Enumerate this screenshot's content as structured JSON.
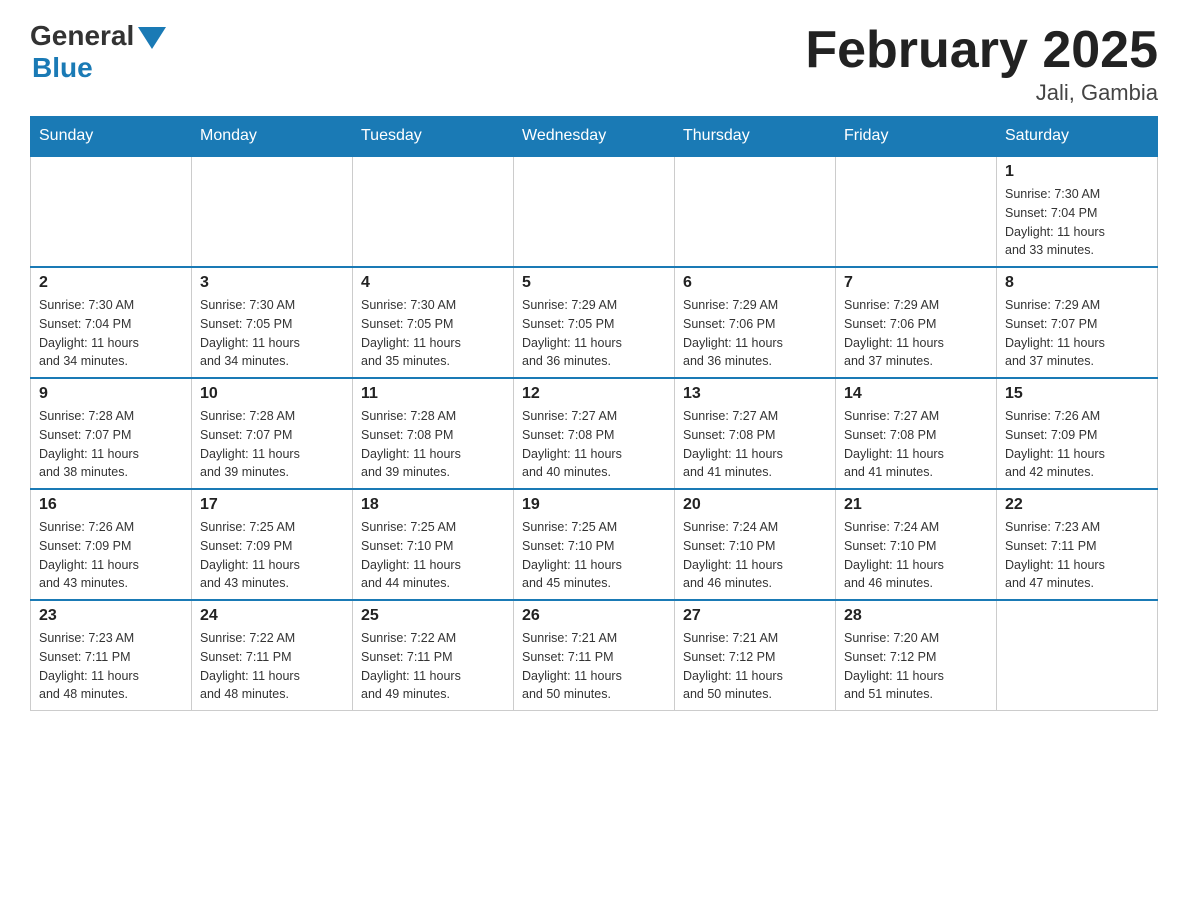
{
  "header": {
    "logo_general": "General",
    "logo_blue": "Blue",
    "title": "February 2025",
    "location": "Jali, Gambia"
  },
  "days_of_week": [
    "Sunday",
    "Monday",
    "Tuesday",
    "Wednesday",
    "Thursday",
    "Friday",
    "Saturday"
  ],
  "weeks": [
    {
      "days": [
        {
          "number": "",
          "info": ""
        },
        {
          "number": "",
          "info": ""
        },
        {
          "number": "",
          "info": ""
        },
        {
          "number": "",
          "info": ""
        },
        {
          "number": "",
          "info": ""
        },
        {
          "number": "",
          "info": ""
        },
        {
          "number": "1",
          "info": "Sunrise: 7:30 AM\nSunset: 7:04 PM\nDaylight: 11 hours\nand 33 minutes."
        }
      ]
    },
    {
      "days": [
        {
          "number": "2",
          "info": "Sunrise: 7:30 AM\nSunset: 7:04 PM\nDaylight: 11 hours\nand 34 minutes."
        },
        {
          "number": "3",
          "info": "Sunrise: 7:30 AM\nSunset: 7:05 PM\nDaylight: 11 hours\nand 34 minutes."
        },
        {
          "number": "4",
          "info": "Sunrise: 7:30 AM\nSunset: 7:05 PM\nDaylight: 11 hours\nand 35 minutes."
        },
        {
          "number": "5",
          "info": "Sunrise: 7:29 AM\nSunset: 7:05 PM\nDaylight: 11 hours\nand 36 minutes."
        },
        {
          "number": "6",
          "info": "Sunrise: 7:29 AM\nSunset: 7:06 PM\nDaylight: 11 hours\nand 36 minutes."
        },
        {
          "number": "7",
          "info": "Sunrise: 7:29 AM\nSunset: 7:06 PM\nDaylight: 11 hours\nand 37 minutes."
        },
        {
          "number": "8",
          "info": "Sunrise: 7:29 AM\nSunset: 7:07 PM\nDaylight: 11 hours\nand 37 minutes."
        }
      ]
    },
    {
      "days": [
        {
          "number": "9",
          "info": "Sunrise: 7:28 AM\nSunset: 7:07 PM\nDaylight: 11 hours\nand 38 minutes."
        },
        {
          "number": "10",
          "info": "Sunrise: 7:28 AM\nSunset: 7:07 PM\nDaylight: 11 hours\nand 39 minutes."
        },
        {
          "number": "11",
          "info": "Sunrise: 7:28 AM\nSunset: 7:08 PM\nDaylight: 11 hours\nand 39 minutes."
        },
        {
          "number": "12",
          "info": "Sunrise: 7:27 AM\nSunset: 7:08 PM\nDaylight: 11 hours\nand 40 minutes."
        },
        {
          "number": "13",
          "info": "Sunrise: 7:27 AM\nSunset: 7:08 PM\nDaylight: 11 hours\nand 41 minutes."
        },
        {
          "number": "14",
          "info": "Sunrise: 7:27 AM\nSunset: 7:08 PM\nDaylight: 11 hours\nand 41 minutes."
        },
        {
          "number": "15",
          "info": "Sunrise: 7:26 AM\nSunset: 7:09 PM\nDaylight: 11 hours\nand 42 minutes."
        }
      ]
    },
    {
      "days": [
        {
          "number": "16",
          "info": "Sunrise: 7:26 AM\nSunset: 7:09 PM\nDaylight: 11 hours\nand 43 minutes."
        },
        {
          "number": "17",
          "info": "Sunrise: 7:25 AM\nSunset: 7:09 PM\nDaylight: 11 hours\nand 43 minutes."
        },
        {
          "number": "18",
          "info": "Sunrise: 7:25 AM\nSunset: 7:10 PM\nDaylight: 11 hours\nand 44 minutes."
        },
        {
          "number": "19",
          "info": "Sunrise: 7:25 AM\nSunset: 7:10 PM\nDaylight: 11 hours\nand 45 minutes."
        },
        {
          "number": "20",
          "info": "Sunrise: 7:24 AM\nSunset: 7:10 PM\nDaylight: 11 hours\nand 46 minutes."
        },
        {
          "number": "21",
          "info": "Sunrise: 7:24 AM\nSunset: 7:10 PM\nDaylight: 11 hours\nand 46 minutes."
        },
        {
          "number": "22",
          "info": "Sunrise: 7:23 AM\nSunset: 7:11 PM\nDaylight: 11 hours\nand 47 minutes."
        }
      ]
    },
    {
      "days": [
        {
          "number": "23",
          "info": "Sunrise: 7:23 AM\nSunset: 7:11 PM\nDaylight: 11 hours\nand 48 minutes."
        },
        {
          "number": "24",
          "info": "Sunrise: 7:22 AM\nSunset: 7:11 PM\nDaylight: 11 hours\nand 48 minutes."
        },
        {
          "number": "25",
          "info": "Sunrise: 7:22 AM\nSunset: 7:11 PM\nDaylight: 11 hours\nand 49 minutes."
        },
        {
          "number": "26",
          "info": "Sunrise: 7:21 AM\nSunset: 7:11 PM\nDaylight: 11 hours\nand 50 minutes."
        },
        {
          "number": "27",
          "info": "Sunrise: 7:21 AM\nSunset: 7:12 PM\nDaylight: 11 hours\nand 50 minutes."
        },
        {
          "number": "28",
          "info": "Sunrise: 7:20 AM\nSunset: 7:12 PM\nDaylight: 11 hours\nand 51 minutes."
        },
        {
          "number": "",
          "info": ""
        }
      ]
    }
  ]
}
